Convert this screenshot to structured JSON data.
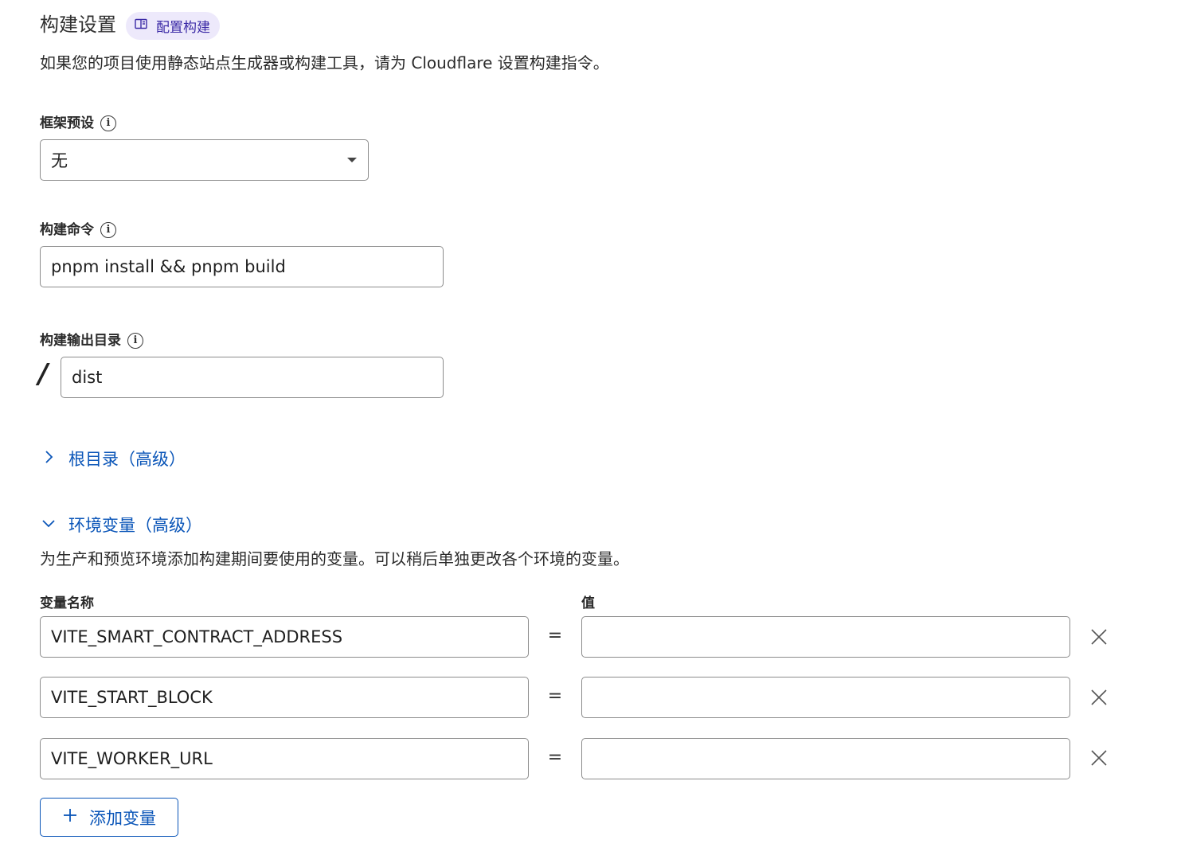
{
  "header": {
    "title": "构建设置",
    "doc_link_label": "配置构建",
    "subtitle": "如果您的项目使用静态站点生成器或构建工具，请为 Cloudflare 设置构建指令。"
  },
  "framework": {
    "label": "框架预设",
    "selected": "无"
  },
  "build_command": {
    "label": "构建命令",
    "value": "pnpm install && pnpm build"
  },
  "output_dir": {
    "label": "构建输出目录",
    "prefix": "/",
    "value": "dist"
  },
  "root_dir": {
    "label": "根目录（高级）",
    "expanded": false
  },
  "env_vars": {
    "label": "环境变量（高级）",
    "expanded": true,
    "description": "为生产和预览环境添加构建期间要使用的变量。可以稍后单独更改各个环境的变量。",
    "name_header": "变量名称",
    "value_header": "值",
    "equals": "=",
    "rows": [
      {
        "name": "VITE_SMART_CONTRACT_ADDRESS",
        "value": ""
      },
      {
        "name": "VITE_START_BLOCK",
        "value": ""
      },
      {
        "name": "VITE_WORKER_URL",
        "value": ""
      }
    ],
    "add_label": "添加变量"
  },
  "colors": {
    "link": "#0a55b8",
    "pill_bg": "#ede9fb",
    "pill_text": "#3b2aa6",
    "border": "#8c8c8c"
  }
}
